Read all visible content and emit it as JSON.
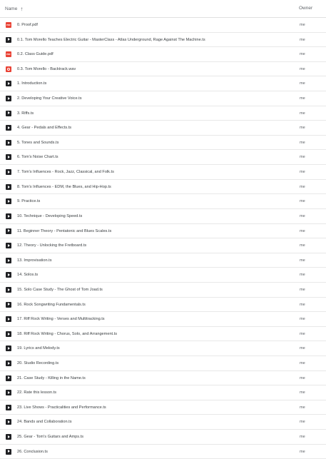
{
  "header": {
    "name_label": "Name",
    "owner_label": "Owner"
  },
  "files": [
    {
      "name": "0. Proof.pdf",
      "owner": "me",
      "icon": "pdf-icon"
    },
    {
      "name": "0.1. Tom Morello Teaches Electric Guitar - MasterClass - Atlas Underground, Rage Against The Machine.ts",
      "owner": "me",
      "icon": "video-icon"
    },
    {
      "name": "0.2. Class Guide.pdf",
      "owner": "me",
      "icon": "pdf-icon"
    },
    {
      "name": "0.3. Tom Morello - Backtrack.wav",
      "owner": "me",
      "icon": "audio-icon"
    },
    {
      "name": "1. Introduction.ts",
      "owner": "me",
      "icon": "video-icon"
    },
    {
      "name": "2. Developing Your Creative Voice.ts",
      "owner": "me",
      "icon": "video-icon"
    },
    {
      "name": "3. Riffs.ts",
      "owner": "me",
      "icon": "video-icon"
    },
    {
      "name": "4. Gear - Pedals and Effects.ts",
      "owner": "me",
      "icon": "video-icon"
    },
    {
      "name": "5. Tones and Sounds.ts",
      "owner": "me",
      "icon": "video-icon"
    },
    {
      "name": "6. Tom's Noise Chart.ts",
      "owner": "me",
      "icon": "video-icon"
    },
    {
      "name": "7. Tom's Influences - Rock, Jazz, Classical, and Folk.ts",
      "owner": "me",
      "icon": "video-icon"
    },
    {
      "name": "8. Tom's Influences - EDM, the Blues, and Hip-Hop.ts",
      "owner": "me",
      "icon": "video-icon"
    },
    {
      "name": "9. Practice.ts",
      "owner": "me",
      "icon": "video-icon"
    },
    {
      "name": "10. Technique - Developing Speed.ts",
      "owner": "me",
      "icon": "video-icon"
    },
    {
      "name": "11. Beginner Theory - Pentatonic and Blues Scales.ts",
      "owner": "me",
      "icon": "video-icon"
    },
    {
      "name": "12. Theory - Unlocking the Fretboard.ts",
      "owner": "me",
      "icon": "video-icon"
    },
    {
      "name": "13. Improvisation.ts",
      "owner": "me",
      "icon": "video-icon"
    },
    {
      "name": "14. Solos.ts",
      "owner": "me",
      "icon": "video-icon"
    },
    {
      "name": "15. Solo Case Study - The Ghost of Tom Joad.ts",
      "owner": "me",
      "icon": "video-icon"
    },
    {
      "name": "16. Rock Songwriting Fundamentals.ts",
      "owner": "me",
      "icon": "video-icon"
    },
    {
      "name": "17. Riff Rock Writing - Verses and Multitracking.ts",
      "owner": "me",
      "icon": "video-icon"
    },
    {
      "name": "18. Riff Rock Writing - Chorus, Solo, and Arrangement.ts",
      "owner": "me",
      "icon": "video-icon"
    },
    {
      "name": "19. Lyrics and Melody.ts",
      "owner": "me",
      "icon": "video-icon"
    },
    {
      "name": "20. Studio Recording.ts",
      "owner": "me",
      "icon": "video-icon"
    },
    {
      "name": "21. Case Study - Killing in the Name.ts",
      "owner": "me",
      "icon": "video-icon"
    },
    {
      "name": "22. Rate this lesson.ts",
      "owner": "me",
      "icon": "video-icon"
    },
    {
      "name": "23. Live Shows - Practicalities and Performance.ts",
      "owner": "me",
      "icon": "video-icon"
    },
    {
      "name": "24. Bands and Collaboration.ts",
      "owner": "me",
      "icon": "video-icon"
    },
    {
      "name": "25. Gear - Tom's Guitars and Amps.ts",
      "owner": "me",
      "icon": "video-icon"
    },
    {
      "name": "26. Conclusion.ts",
      "owner": "me",
      "icon": "video-icon"
    }
  ]
}
